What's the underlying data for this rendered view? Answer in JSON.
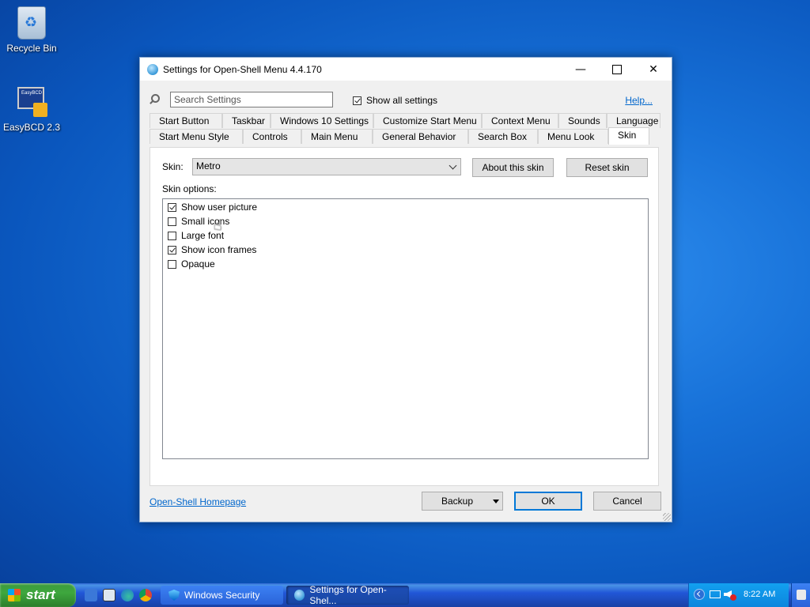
{
  "desktop": {
    "icons": [
      {
        "label": "Recycle Bin",
        "icon": "recycle-bin-icon"
      },
      {
        "label": "EasyBCD 2.3",
        "icon": "easybcd-icon",
        "icon_text": "EasyBCD"
      }
    ]
  },
  "window": {
    "title": "Settings for Open-Shell Menu 4.4.170",
    "controls": {
      "minimize": "—",
      "close": "✕"
    },
    "search": {
      "placeholder": "Search Settings",
      "value": ""
    },
    "show_all_settings": {
      "label": "Show all settings",
      "checked": true
    },
    "help_link": "Help...",
    "tabs_row1": [
      "Start Button",
      "Taskbar",
      "Windows 10 Settings",
      "Customize Start Menu",
      "Context Menu",
      "Sounds",
      "Language"
    ],
    "tabs_row2": [
      "Start Menu Style",
      "Controls",
      "Main Menu",
      "General Behavior",
      "Search Box",
      "Menu Look",
      "Skin"
    ],
    "active_tab": "Skin",
    "skin": {
      "label": "Skin:",
      "selected": "Metro",
      "about_button": "About this skin",
      "reset_button": "Reset skin"
    },
    "skin_options_label": "Skin options:",
    "skin_options": [
      {
        "label": "Show user picture",
        "checked": true
      },
      {
        "label": "Small icons",
        "checked": false
      },
      {
        "label": "Large font",
        "checked": false
      },
      {
        "label": "Show icon frames",
        "checked": true
      },
      {
        "label": "Opaque",
        "checked": false
      }
    ],
    "footer": {
      "homepage_link": "Open-Shell Homepage",
      "backup_button": "Backup",
      "ok_button": "OK",
      "cancel_button": "Cancel"
    }
  },
  "taskbar": {
    "start_label": "start",
    "tasks": [
      {
        "label": "Windows Security",
        "active": false
      },
      {
        "label": "Settings for Open-Shel...",
        "active": true
      }
    ],
    "clock": "8:22 AM"
  }
}
